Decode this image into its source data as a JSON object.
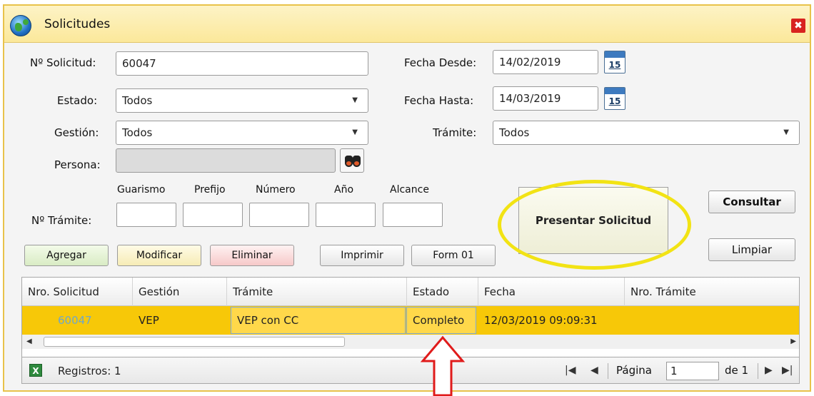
{
  "window": {
    "title": "Solicitudes",
    "close_label": "✖",
    "accent": "#f7c808",
    "highlight_color": "#f2e314",
    "arrow_color": "#e01b1b"
  },
  "form": {
    "solicitud": {
      "label": "Nº Solicitud:",
      "value": "60047"
    },
    "estado": {
      "label": "Estado:",
      "value": "Todos"
    },
    "gestion": {
      "label": "Gestión:",
      "value": "Todos"
    },
    "persona": {
      "label": "Persona:",
      "value": ""
    },
    "fecha_desde": {
      "label": "Fecha Desde:",
      "value": "14/02/2019",
      "cal_day": "15"
    },
    "fecha_hasta": {
      "label": "Fecha Hasta:",
      "value": "14/03/2019",
      "cal_day": "15"
    },
    "tramite_select": {
      "label": "Trámite:",
      "value": "Todos"
    },
    "tramite_number": {
      "label": "Nº Trámite:",
      "parts": [
        "Guarismo",
        "Prefijo",
        "Número",
        "Año",
        "Alcance"
      ]
    }
  },
  "buttons": {
    "agregar": "Agregar",
    "modificar": "Modificar",
    "eliminar": "Eliminar",
    "imprimir": "Imprimir",
    "form01": "Form 01",
    "presentar": "Presentar Solicitud",
    "consultar": "Consultar",
    "limpiar": "Limpiar"
  },
  "grid": {
    "columns": [
      "Nro. Solicitud",
      "Gestión",
      "Trámite",
      "Estado",
      "Fecha",
      "Nro. Trámite"
    ],
    "rows": [
      {
        "nro_solicitud": "60047",
        "gestion": "VEP",
        "tramite": "VEP con CC",
        "estado": "Completo",
        "fecha": "12/03/2019 09:09:31",
        "nro_tramite": ""
      }
    ]
  },
  "footer": {
    "excel_icon": "excel-icon",
    "registros": "Registros: 1",
    "pagina_label": "Página",
    "pagina_value": "1",
    "de_label": "de 1"
  }
}
